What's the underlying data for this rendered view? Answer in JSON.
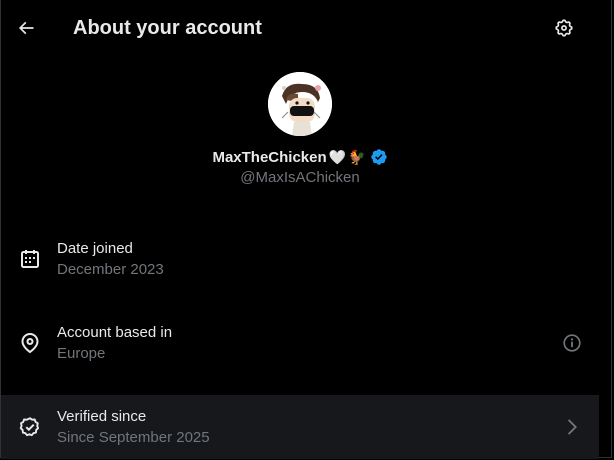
{
  "header": {
    "title": "About your account",
    "back_icon": "arrow-left-icon",
    "settings_icon": "gear-icon"
  },
  "profile": {
    "display_name": "MaxTheChicken",
    "name_emojis": [
      "🤍",
      "🐓"
    ],
    "verified_badge": "verified-check-icon",
    "handle": "@MaxIsAChicken"
  },
  "rows": [
    {
      "icon": "calendar-icon",
      "label": "Date joined",
      "value": "December 2023"
    },
    {
      "icon": "location-pin-icon",
      "label": "Account based in",
      "value": "Europe",
      "trail_icon": "info-icon"
    },
    {
      "icon": "verified-circle-icon",
      "label": "Verified since",
      "value": "Since September 2025",
      "trail_icon": "chevron-right-icon"
    }
  ],
  "colors": {
    "background": "#000000",
    "text_primary": "#e7e9ea",
    "text_secondary": "#71767b",
    "verified_blue": "#1d9bf0",
    "row_hover": "#16181c"
  }
}
